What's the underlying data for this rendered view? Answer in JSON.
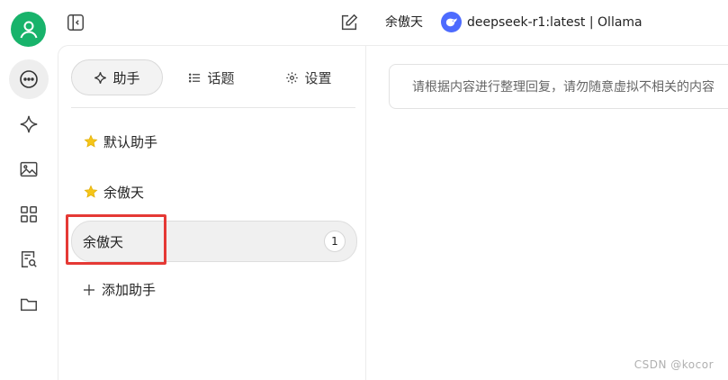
{
  "header": {
    "assistant_name": "余傲天",
    "model_label": "deepseek-r1:latest | Ollama"
  },
  "rail": {
    "items": [
      "chat-icon",
      "sparkle-icon",
      "image-icon",
      "apps-icon",
      "doc-search-icon",
      "folder-icon"
    ],
    "active": "chat-icon"
  },
  "tabs": [
    {
      "label": "助手",
      "icon": "sparkle-icon",
      "active": true
    },
    {
      "label": "话题",
      "icon": "list-icon",
      "active": false
    },
    {
      "label": "设置",
      "icon": "gear-icon",
      "active": false
    }
  ],
  "assistants": [
    {
      "label": "默认助手",
      "starred": true
    },
    {
      "label": "余傲天",
      "starred": true
    },
    {
      "label": "余傲天",
      "starred": false,
      "selected": true,
      "count": "1"
    }
  ],
  "add_assistant_label": "添加助手",
  "prompt": {
    "text": "请根据内容进行整理回复，请勿随意虚拟不相关的内容"
  },
  "watermark": "CSDN @kocor",
  "colors": {
    "avatar": "#18b36b",
    "star": "#f5c518",
    "highlight": "#e53935",
    "model_logo": "#4d6bfe"
  }
}
